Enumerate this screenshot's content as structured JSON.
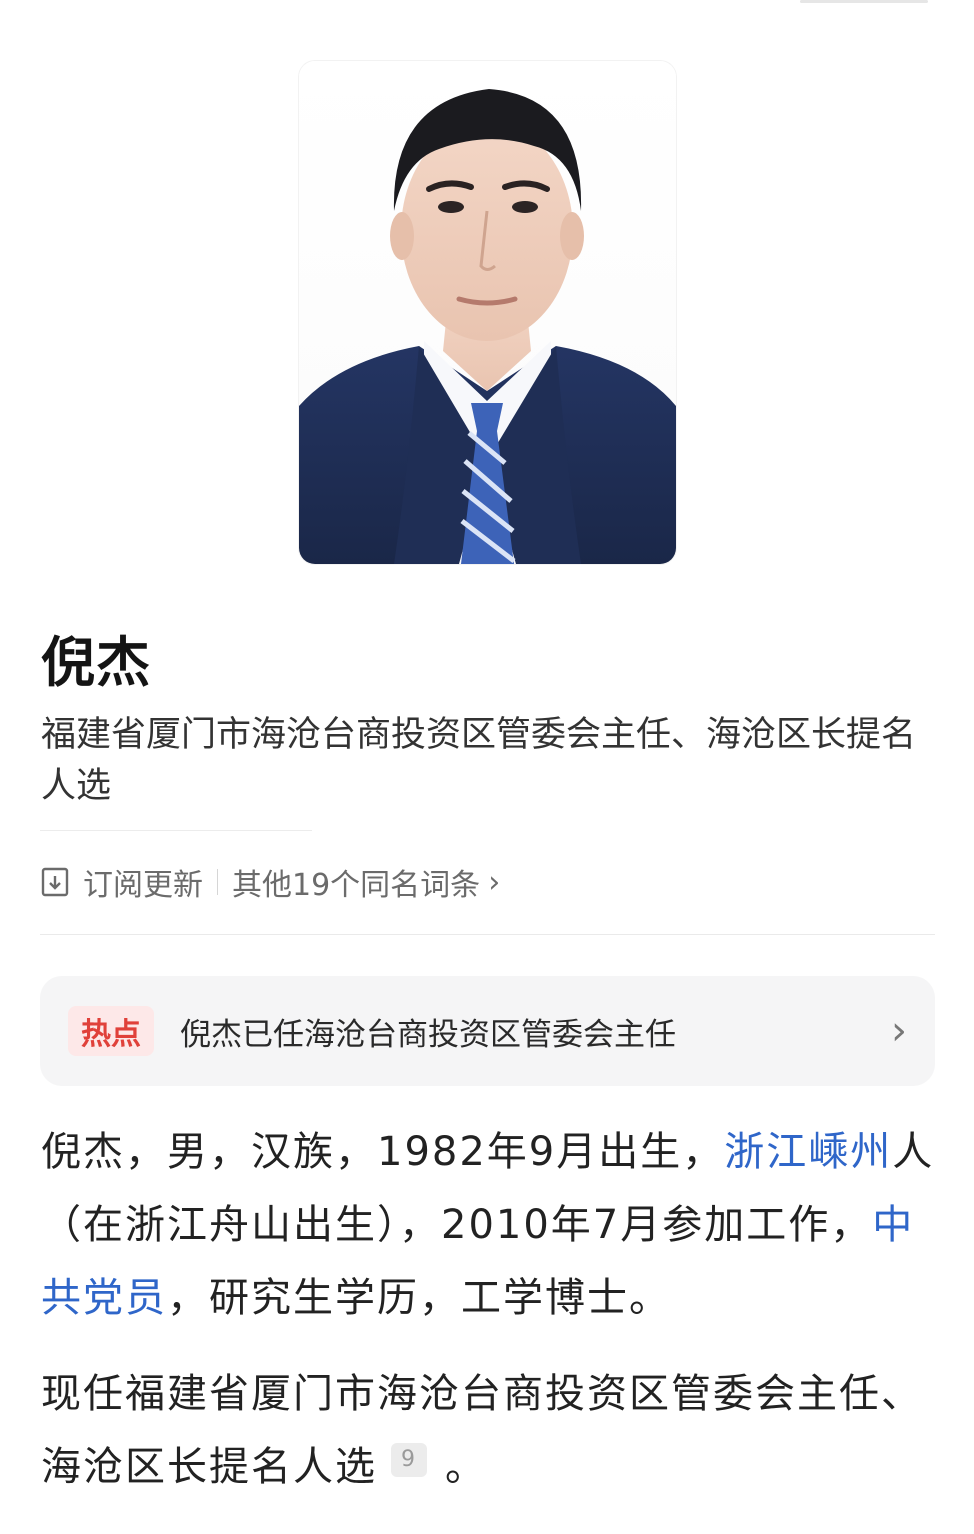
{
  "person": {
    "name": "倪杰",
    "subtitle": "福建省厦门市海沧台商投资区管委会主任、海沧区长提名人选"
  },
  "actions": {
    "subscribe_label": "订阅更新",
    "same_name_label": "其他19个同名词条"
  },
  "hot": {
    "badge": "热点",
    "text": "倪杰已任海沧台商投资区管委会主任"
  },
  "intro": {
    "p1_a": "倪杰，男，汉族，1982年9月出生，",
    "p1_link1": "浙江嵊州",
    "p1_b": "人（在浙江舟山出生），2010年7月参加工作，",
    "p1_link2": "中共党员",
    "p1_c": "，研究生学历，工学博士。",
    "p2_a": "现任福建省厦门市海沧台商投资区管委会主任、海沧区长提名人选",
    "p2_ref": "9",
    "p2_b": "。"
  },
  "colors": {
    "link": "#2f66c9",
    "hot_badge_bg": "#fde8e8",
    "hot_badge_text": "#e0413a"
  },
  "icons": {
    "bookmark": "bookmark-icon",
    "chevron": "chevron-right-icon"
  }
}
